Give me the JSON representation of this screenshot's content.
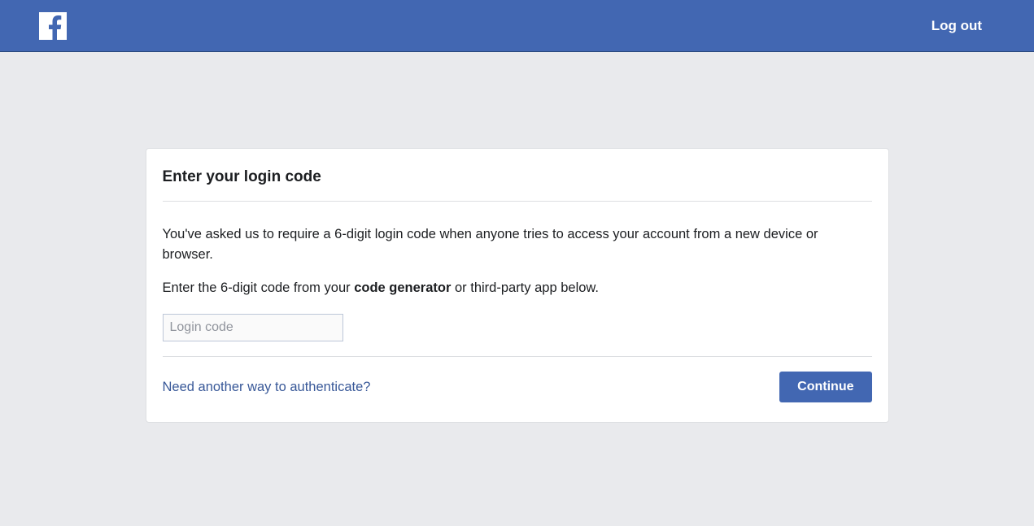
{
  "header": {
    "logout_label": "Log out"
  },
  "card": {
    "title": "Enter your login code",
    "description1": "You've asked us to require a 6-digit login code when anyone tries to access your account from a new device or browser.",
    "description2_pre": "Enter the 6-digit code from your ",
    "description2_bold": "code generator",
    "description2_post": " or third-party app below.",
    "input_placeholder": "Login code",
    "help_link": "Need another way to authenticate?",
    "continue_label": "Continue"
  }
}
